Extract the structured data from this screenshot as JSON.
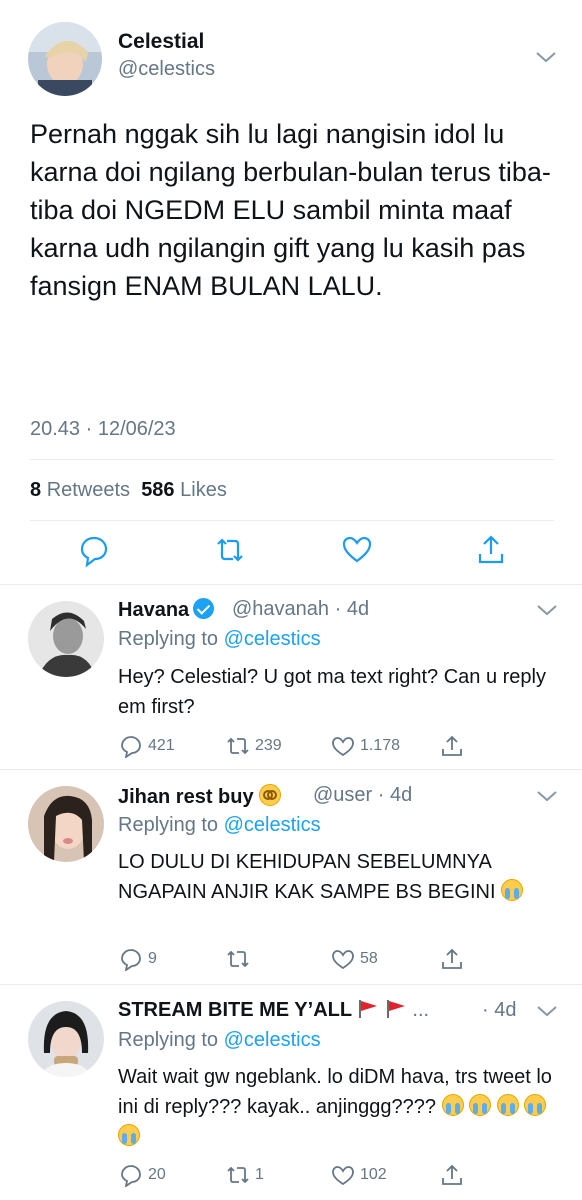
{
  "main_tweet": {
    "author_name": "Celestial",
    "author_handle": "@celestics",
    "text": "Pernah nggak sih lu lagi nangisin idol lu karna doi ngilang berbulan-bulan terus tiba-tiba doi NGEDM ELU sambil minta maaf karna udh ngilangin gift yang lu kasih pas fansign ENAM BULAN LALU.",
    "timestamp": "20.43 · 12/06/23",
    "retweets_count": "8",
    "retweets_label": "Retweets",
    "likes_count": "586",
    "likes_label": "Likes",
    "icons": [
      "reply-icon",
      "retweet-icon",
      "like-icon",
      "share-icon"
    ]
  },
  "replies": [
    {
      "name": "Havana",
      "verified": true,
      "handle_time": "@havanah · 4d",
      "replying_prefix": "Replying to",
      "replying_to": "@celestics",
      "text": "Hey? Celestial? U got ma text right? Can u reply em first?",
      "reply_count": "421",
      "retweet_count": "239",
      "like_count": "1.178"
    },
    {
      "name": "Jihan rest buy",
      "name_emoji": "woozy-face",
      "handle_time": "@user · 4d",
      "replying_prefix": "Replying to",
      "replying_to": "@celestics",
      "text": "LO DULU DI KEHIDUPAN SEBELUMNYA NGAPAIN ANJIR KAK SAMPE BS BEGINI",
      "text_emoji": "loudly-crying-face",
      "reply_count": "9",
      "retweet_count": "",
      "like_count": "58"
    },
    {
      "name": "STREAM BITE ME Y’ALL",
      "name_emoji": "red-flag x2",
      "name_ellipsis": "...",
      "handle_time": "· 4d",
      "replying_prefix": "Replying to",
      "replying_to": "@celestics",
      "text": "Wait wait gw ngeblank. lo diDM hava, trs tweet lo ini di reply??? kayak.. anjinggg????",
      "text_emoji": "loudly-crying-face x5",
      "reply_count": "20",
      "retweet_count": "1",
      "like_count": "102"
    }
  ],
  "colors": {
    "text": "#0f1419",
    "secondary": "#657786",
    "link": "#1da1f2",
    "divider": "#e6ecf0"
  }
}
